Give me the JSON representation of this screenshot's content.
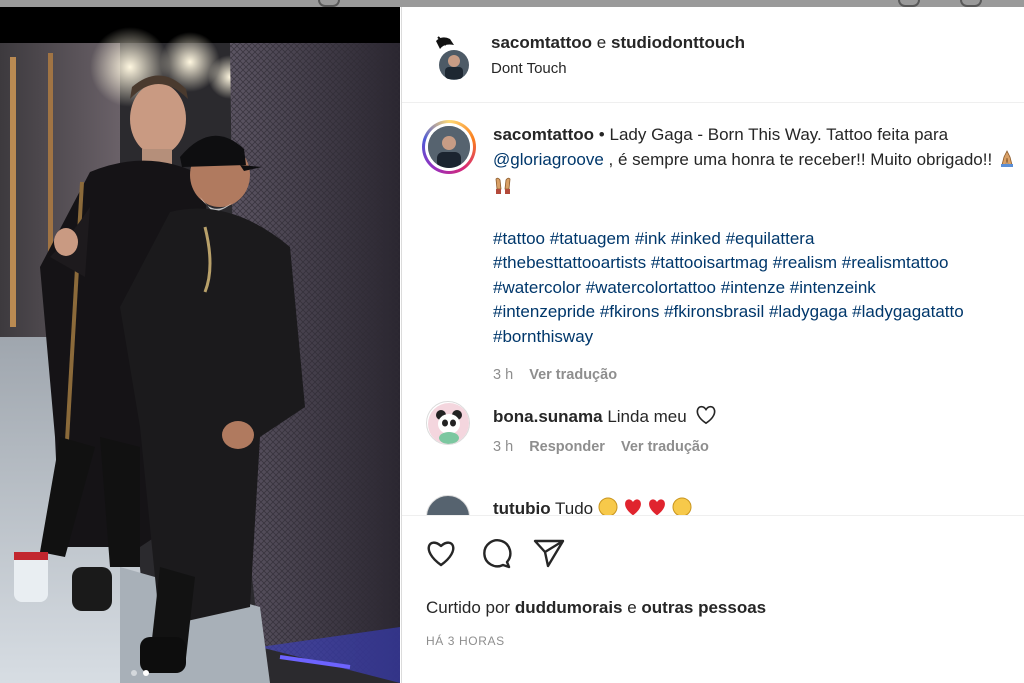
{
  "post": {
    "header": {
      "username": "sacomtattoo",
      "connector": " e ",
      "collaborator": "studiodonttouch",
      "location": "Dont Touch",
      "avatar_icon": "skull-logo-avatar"
    },
    "caption": {
      "username": "sacomtattoo",
      "bullet": " • ",
      "text_before_mention": "Lady Gaga - Born This Way. Tattoo feita para ",
      "mention": "@gloriagroove",
      "text_after_mention": " , é sempre uma honra te receber!! Muito obrigado!!",
      "emojis": [
        "folded-hands-emoji",
        "raising-hands-emoji"
      ],
      "hashtag_lines": [
        [
          "#tattoo",
          "#tatuagem",
          "#ink",
          "#inked",
          "#equilattera"
        ],
        [
          "#thebesttattooartists",
          "#tattooisartmag",
          "#realism",
          "#realismtattoo"
        ],
        [
          "#watercolor",
          "#watercolortattoo",
          "#intenze",
          "#intenzeink"
        ],
        [
          "#intenzepride",
          "#fkirons",
          "#fkironsbrasil",
          "#ladygaga",
          "#ladygagatatto"
        ],
        [
          "#bornthisway"
        ]
      ],
      "time": "3 h",
      "translate": "Ver tradução"
    },
    "comments": [
      {
        "username": "bona.sunama",
        "text": "Linda meu",
        "time": "3 h",
        "reply": "Responder",
        "translate": "Ver tradução",
        "avatar_icon": "panda-avatar"
      },
      {
        "username": "tutubio",
        "text": "Tudo",
        "avatar_icon": "user-avatar"
      }
    ],
    "actions": {
      "like_icon": "heart-icon",
      "comment_icon": "comment-icon",
      "share_icon": "share-icon"
    },
    "liked_by": {
      "prefix": "Curtido por ",
      "user": "duddumorais",
      "connector": " e ",
      "others": "outras pessoas"
    },
    "timestamp": "HÁ 3 HORAS",
    "carousel": {
      "current": 2,
      "total": 2
    }
  },
  "colors": {
    "link": "#00376b",
    "muted": "#8e8e8e",
    "text": "#262626"
  }
}
